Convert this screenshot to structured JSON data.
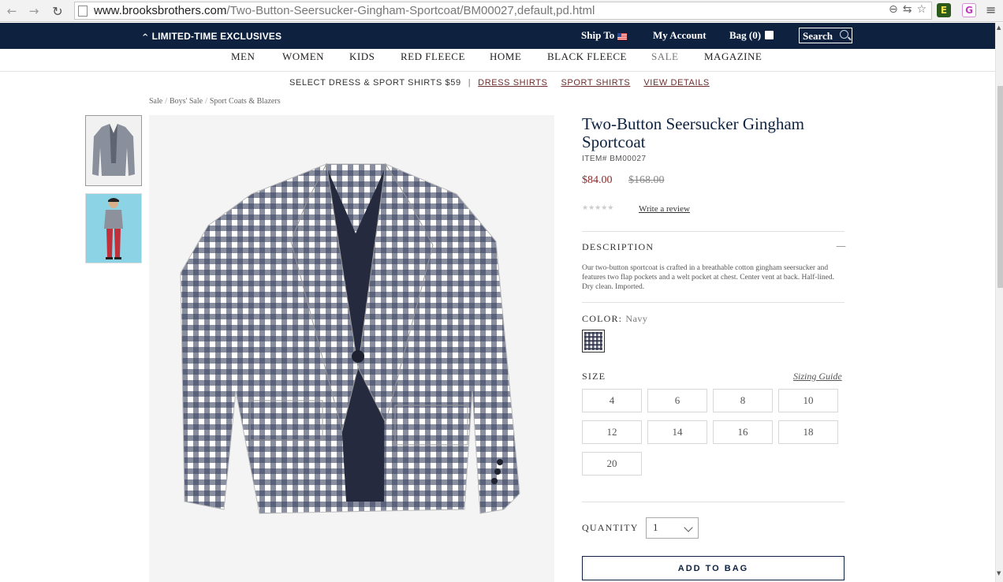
{
  "browser": {
    "url_host": "www.brooksbrothers.com",
    "url_path": "/Two-Button-Seersucker-Gingham-Sportcoat/BM00027,default,pd.html",
    "back_icon": "←",
    "forward_icon": "→",
    "reload_icon": "↻",
    "zoom_icon": "⊖",
    "translate_icon": "⇆",
    "star_icon": "☆",
    "ext1_label": "E",
    "ext2_label": "G",
    "menu_icon": "≡"
  },
  "topbar": {
    "exclusives_chev": "^",
    "exclusives": "LIMITED-TIME EXCLUSIVES",
    "ship_to": "Ship To",
    "my_account": "My Account",
    "bag": "Bag (0)",
    "search_label": "Search"
  },
  "categories": [
    "MEN",
    "WOMEN",
    "KIDS",
    "RED FLEECE",
    "HOME",
    "BLACK FLEECE",
    "SALE",
    "MAGAZINE"
  ],
  "promo": {
    "text": "SELECT DRESS & SPORT SHIRTS $59",
    "sep": "|",
    "links": [
      "DRESS SHIRTS",
      "SPORT SHIRTS",
      "VIEW DETAILS"
    ]
  },
  "breadcrumb": [
    "Sale",
    "Boys' Sale",
    "Sport Coats & Blazers"
  ],
  "breadcrumb_sep": "/",
  "product": {
    "title": "Two-Button Seersucker Gingham Sportcoat",
    "item_no": "ITEM# BM00027",
    "price": "$84.00",
    "old_price": "$168.00",
    "rating_stars": "★★★★★",
    "rating": 0,
    "review_link": "Write a review",
    "description_heading": "DESCRIPTION",
    "collapse_icon": "—",
    "description": "Our two-button sportcoat is crafted in a breathable cotton gingham seersucker and features two flap pockets and a welt pocket at chest. Center vent at back. Half-lined. Dry clean. Imported.",
    "color_label": "COLOR:",
    "color_value": "Navy",
    "size_label": "SIZE",
    "sizing_guide": "Sizing Guide",
    "sizes": [
      "4",
      "6",
      "8",
      "10",
      "12",
      "14",
      "16",
      "18",
      "20"
    ],
    "quantity_label": "QUANTITY",
    "quantity": "1",
    "add_to_bag": "ADD TO BAG"
  },
  "scrollbar": {
    "up_icon": "▲",
    "down_icon": "▼"
  },
  "colors": {
    "navy": "#0e2240",
    "price_red": "#8a2a2a",
    "link_red": "#6d2d2d"
  }
}
